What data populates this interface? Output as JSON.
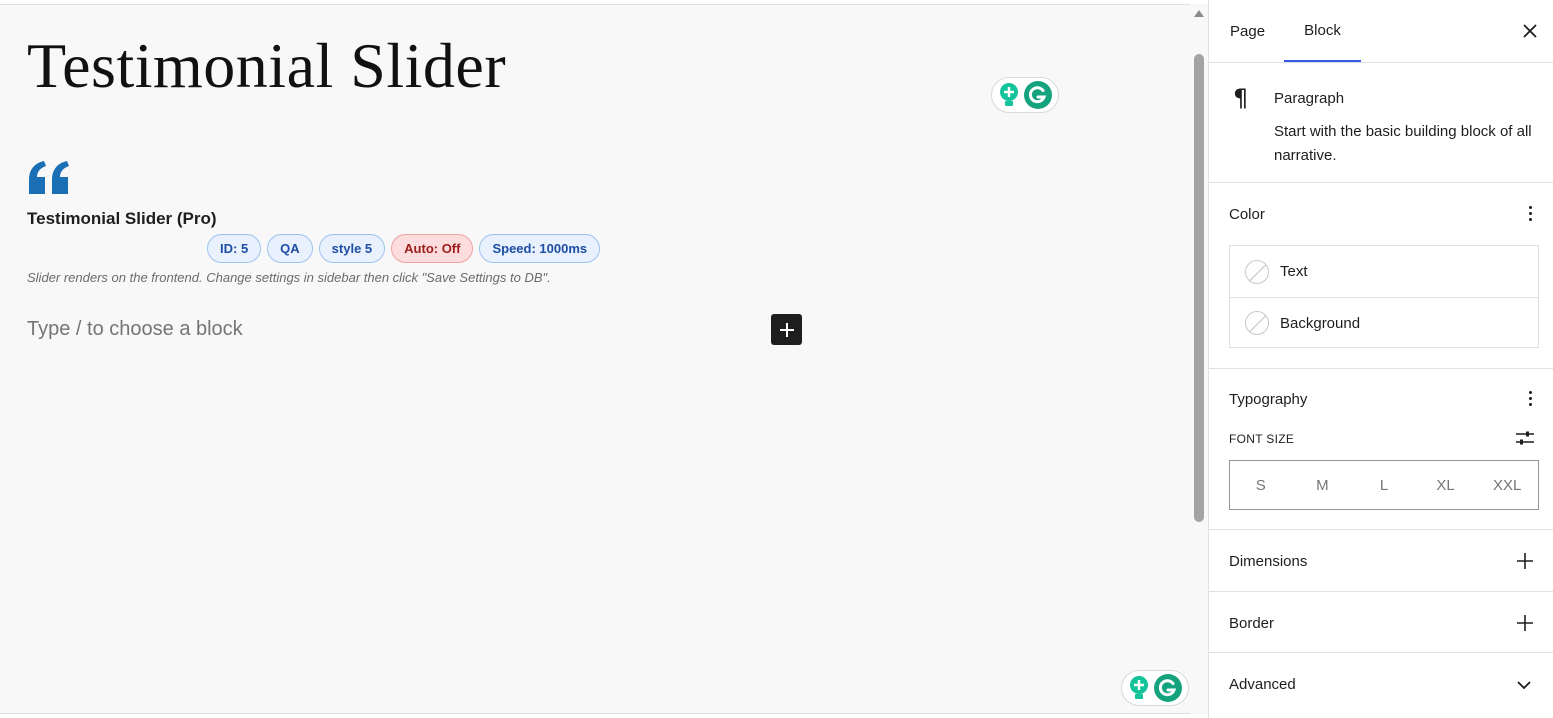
{
  "editor": {
    "post_title": "Testimonial Slider",
    "block": {
      "title": "Testimonial Slider (Pro)",
      "badges": [
        "ID: 5",
        "QA",
        "style 5",
        "Auto: Off",
        "Speed: 1000ms"
      ],
      "hint": "Slider renders on the frontend. Change settings in sidebar then click \"Save Settings to DB\"."
    },
    "placeholder": "Type / to choose a block"
  },
  "sidebar": {
    "tabs": [
      "Page",
      "Block"
    ],
    "active_tab": "Block",
    "block_card": {
      "name": "Paragraph",
      "description": "Start with the basic building block of all narrative."
    },
    "color": {
      "heading": "Color",
      "items": [
        "Text",
        "Background"
      ]
    },
    "typography": {
      "heading": "Typography",
      "font_size_label": "FONT SIZE",
      "sizes": [
        "S",
        "M",
        "L",
        "XL",
        "XXL"
      ]
    },
    "panels": {
      "dimensions": "Dimensions",
      "border": "Border",
      "advanced": "Advanced"
    }
  },
  "colors": {
    "accent": "#3858e9",
    "quote_icon": "#1a6fb5",
    "badge_blue": "#1d4ea3",
    "badge_red": "#9b1c1c",
    "grammarly_green": "#15c39a"
  }
}
